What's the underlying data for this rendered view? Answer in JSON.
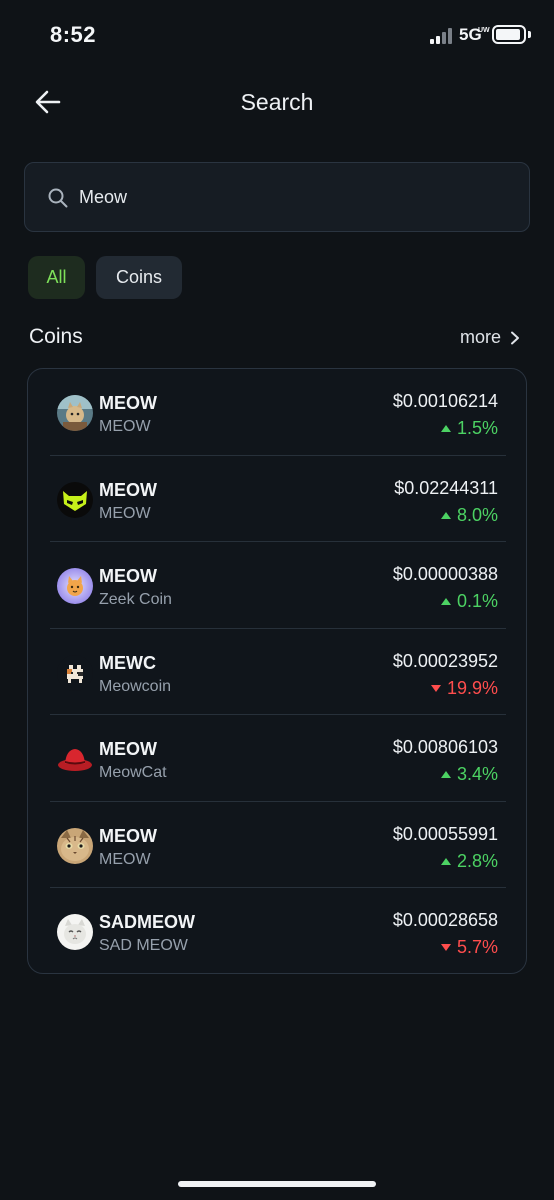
{
  "status_bar": {
    "time": "8:52",
    "network": "5G",
    "network_sup": "UW"
  },
  "header": {
    "title": "Search"
  },
  "search": {
    "value": "Meow"
  },
  "filters": [
    {
      "label": "All",
      "selected": true
    },
    {
      "label": "Coins",
      "selected": false
    }
  ],
  "section": {
    "title": "Coins",
    "more_label": "more"
  },
  "colors": {
    "background": "#0f1317",
    "up": "#4cd263",
    "down": "#ff4d4d",
    "accent_chip": "#7ee05a"
  },
  "coins": [
    {
      "symbol": "MEOW",
      "name": "MEOW",
      "price": "$0.00106214",
      "change": "1.5%",
      "direction": "up",
      "icon": "cat-painting-icon"
    },
    {
      "symbol": "MEOW",
      "name": "MEOW",
      "price": "$0.02244311",
      "change": "8.0%",
      "direction": "up",
      "icon": "neon-cat-mask-icon"
    },
    {
      "symbol": "MEOW",
      "name": "Zeek Coin",
      "price": "$0.00000388",
      "change": "0.1%",
      "direction": "up",
      "icon": "zeek-cat-icon"
    },
    {
      "symbol": "MEWC",
      "name": "Meowcoin",
      "price": "$0.00023952",
      "change": "19.9%",
      "direction": "down",
      "icon": "pixel-cat-icon"
    },
    {
      "symbol": "MEOW",
      "name": "MeowCat",
      "price": "$0.00806103",
      "change": "3.4%",
      "direction": "up",
      "icon": "red-hat-icon"
    },
    {
      "symbol": "MEOW",
      "name": "MEOW",
      "price": "$0.00055991",
      "change": "2.8%",
      "direction": "up",
      "icon": "cat-face-icon"
    },
    {
      "symbol": "SADMEOW",
      "name": "SAD MEOW",
      "price": "$0.00028658",
      "change": "5.7%",
      "direction": "down",
      "icon": "sad-cat-icon"
    }
  ]
}
